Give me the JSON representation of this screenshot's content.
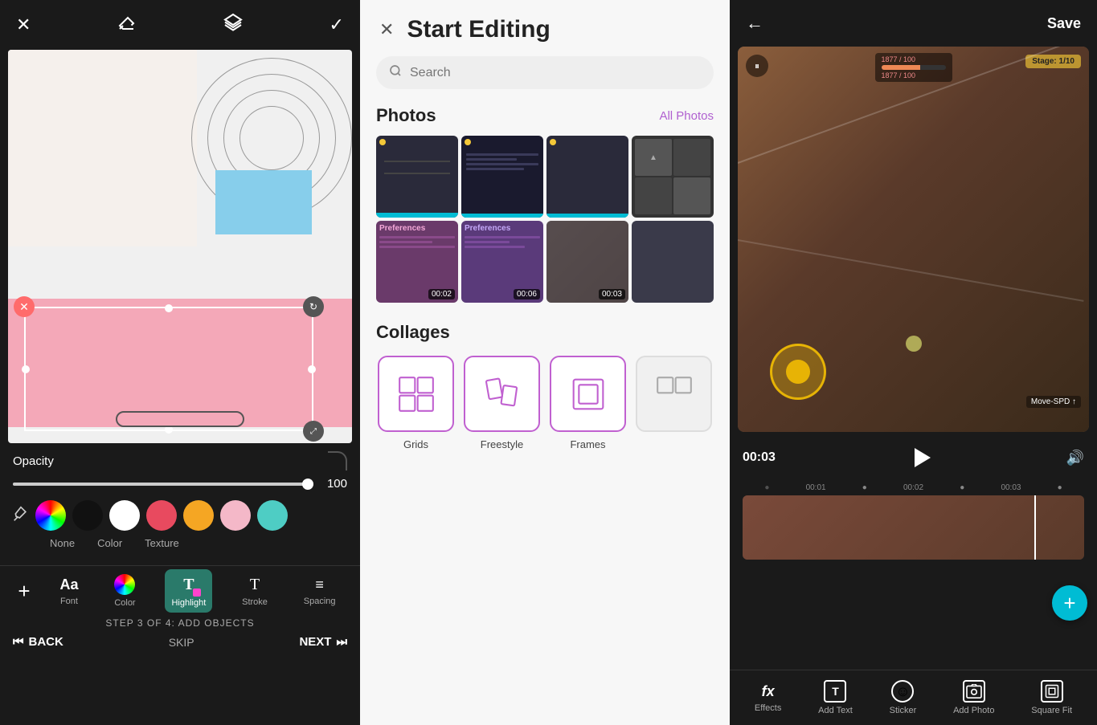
{
  "leftPanel": {
    "closeLabel": "✕",
    "eraserIcon": "eraser",
    "layersIcon": "layers",
    "checkIcon": "✓",
    "opacityLabel": "Opacity",
    "opacityValue": "100",
    "colors": [
      {
        "name": "rainbow",
        "hex": "conic-gradient"
      },
      {
        "name": "black",
        "hex": "#111111"
      },
      {
        "name": "white",
        "hex": "#ffffff"
      },
      {
        "name": "red",
        "hex": "#e84a5f"
      },
      {
        "name": "yellow",
        "hex": "#f5a623"
      },
      {
        "name": "pink",
        "hex": "#f4b8c8"
      },
      {
        "name": "cyan",
        "hex": "#4ecdc4"
      }
    ],
    "colorModes": [
      "None",
      "Color",
      "Texture"
    ],
    "tools": [
      {
        "id": "font",
        "label": "Font",
        "icon": "Aa"
      },
      {
        "id": "color",
        "label": "Color",
        "icon": "●"
      },
      {
        "id": "highlight",
        "label": "Highlight",
        "icon": "T",
        "active": true
      },
      {
        "id": "stroke",
        "label": "Stroke",
        "icon": "T"
      },
      {
        "id": "spacing",
        "label": "Spacing",
        "icon": "≡"
      }
    ],
    "stepLabel": "STEP 3 OF 4: ADD OBJECTS",
    "backLabel": "BACK",
    "skipLabel": "SKIP",
    "nextLabel": "NEXT"
  },
  "middlePanel": {
    "closeIcon": "✕",
    "title": "Start Editing",
    "searchPlaceholder": "Search",
    "photosSection": {
      "title": "Photos",
      "allPhotosLabel": "All Photos",
      "photos": [
        {
          "id": 1,
          "type": "screenshot",
          "hasTime": false
        },
        {
          "id": 2,
          "type": "list",
          "hasTime": false
        },
        {
          "id": 3,
          "type": "dark",
          "hasTime": false
        },
        {
          "id": 4,
          "type": "grid",
          "hasTime": false
        },
        {
          "id": 5,
          "type": "settings",
          "time": "00:02"
        },
        {
          "id": 6,
          "type": "settings2",
          "time": "00:06"
        },
        {
          "id": 7,
          "type": "game",
          "time": "00:03"
        },
        {
          "id": 8,
          "type": "dark2",
          "hasTime": false
        }
      ]
    },
    "collagesSection": {
      "title": "Collages",
      "items": [
        {
          "id": "grids",
          "label": "Grids"
        },
        {
          "id": "freestyle",
          "label": "Freestyle"
        },
        {
          "id": "frames",
          "label": "Frames"
        },
        {
          "id": "more",
          "label": ""
        }
      ]
    }
  },
  "rightPanel": {
    "backIcon": "←",
    "saveLabel": "Save",
    "videoTime": "00:03",
    "playIcon": "play",
    "volumeIcon": "🔊",
    "timeline": {
      "ticks": [
        "00:01",
        "00:02",
        "00:03"
      ]
    },
    "addIcon": "+",
    "tools": [
      {
        "id": "effects",
        "label": "Effects",
        "icon": "fx"
      },
      {
        "id": "addText",
        "label": "Add Text",
        "icon": "T"
      },
      {
        "id": "sticker",
        "label": "Sticker",
        "icon": "☺"
      },
      {
        "id": "addPhoto",
        "label": "Add Photo",
        "icon": "🖼"
      },
      {
        "id": "squareFit",
        "label": "Square Fit",
        "icon": "⊡"
      }
    ]
  }
}
